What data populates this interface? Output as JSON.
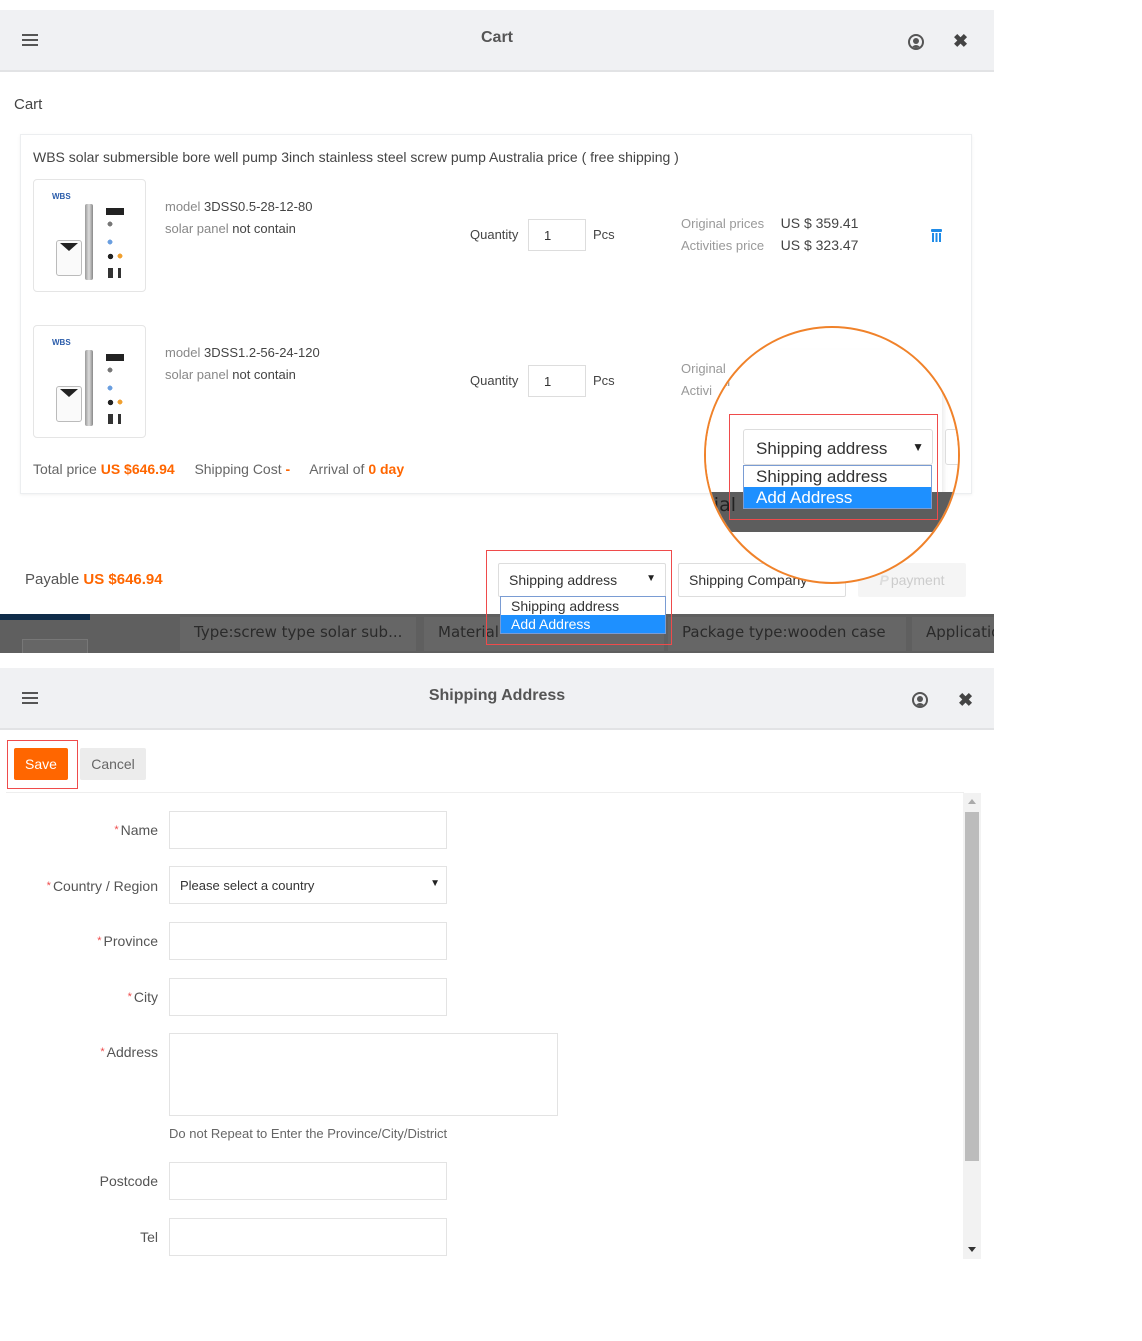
{
  "cart_window": {
    "title": "Cart",
    "section_label": "Cart",
    "product_title": "WBS solar submersible bore well pump 3inch stainless steel screw pump Australia price ( free shipping )",
    "thumbnail_brand": "WBS",
    "items": [
      {
        "model_label": "model",
        "model_value": "3DSS0.5-28-12-80",
        "panel_label": "solar panel",
        "panel_value": "not contain",
        "quantity_label": "Quantity",
        "quantity": "1",
        "unit": "Pcs",
        "original_label": "Original prices",
        "original_price": "US $ 359.41",
        "activity_label": "Activities price",
        "activity_price": "US $ 323.47"
      },
      {
        "model_label": "model",
        "model_value": "3DSS1.2-56-24-120",
        "panel_label": "solar panel",
        "panel_value": "not contain",
        "quantity_label": "Quantity",
        "quantity": "1",
        "unit": "Pcs",
        "original_label": "Original",
        "activity_label": "Activi"
      }
    ],
    "totals": {
      "total_label": "Total price",
      "total_value": "US $646.94",
      "shipping_label": "Shipping Cost",
      "shipping_value": "-",
      "arrival_label": "Arrival of",
      "arrival_value": "0 day"
    },
    "payable": {
      "label": "Payable",
      "value": "US $646.94"
    },
    "shipping_address_select": {
      "selected": "Shipping address",
      "options": [
        "Shipping address",
        "Add Address"
      ],
      "highlighted": "Add Address"
    },
    "shipping_company_select": {
      "selected": "Shipping Company"
    },
    "payment_button": {
      "icon": "P",
      "label": "payment"
    },
    "background_tags": [
      "Type:screw type solar sub...",
      "Material",
      "Package type:wooden case",
      "Applicatio"
    ],
    "magnifier": {
      "original_fragment": "Original",
      "activity_fragment": "Activi",
      "background_fragment": "rial",
      "selected": "Shipping address",
      "options": [
        "Shipping address",
        "Add Address"
      ]
    }
  },
  "address_window": {
    "title": "Shipping Address",
    "save_label": "Save",
    "cancel_label": "Cancel",
    "required_mark": "*",
    "fields": {
      "name": {
        "label": "Name",
        "value": ""
      },
      "country": {
        "label": "Country / Region",
        "placeholder": "Please select a country"
      },
      "province": {
        "label": "Province",
        "value": ""
      },
      "city": {
        "label": "City",
        "value": ""
      },
      "address": {
        "label": "Address",
        "value": "",
        "hint": "Do not Repeat to Enter the Province/City/District"
      },
      "postcode": {
        "label": "Postcode",
        "value": ""
      },
      "tel": {
        "label": "Tel",
        "value": ""
      }
    }
  },
  "colors": {
    "accent_orange": "#ff6600",
    "highlight_blue": "#1e90ff",
    "annotation_red": "#ef4b4b",
    "magnifier_orange": "#f0822a",
    "trash_blue": "#1e8be8"
  }
}
